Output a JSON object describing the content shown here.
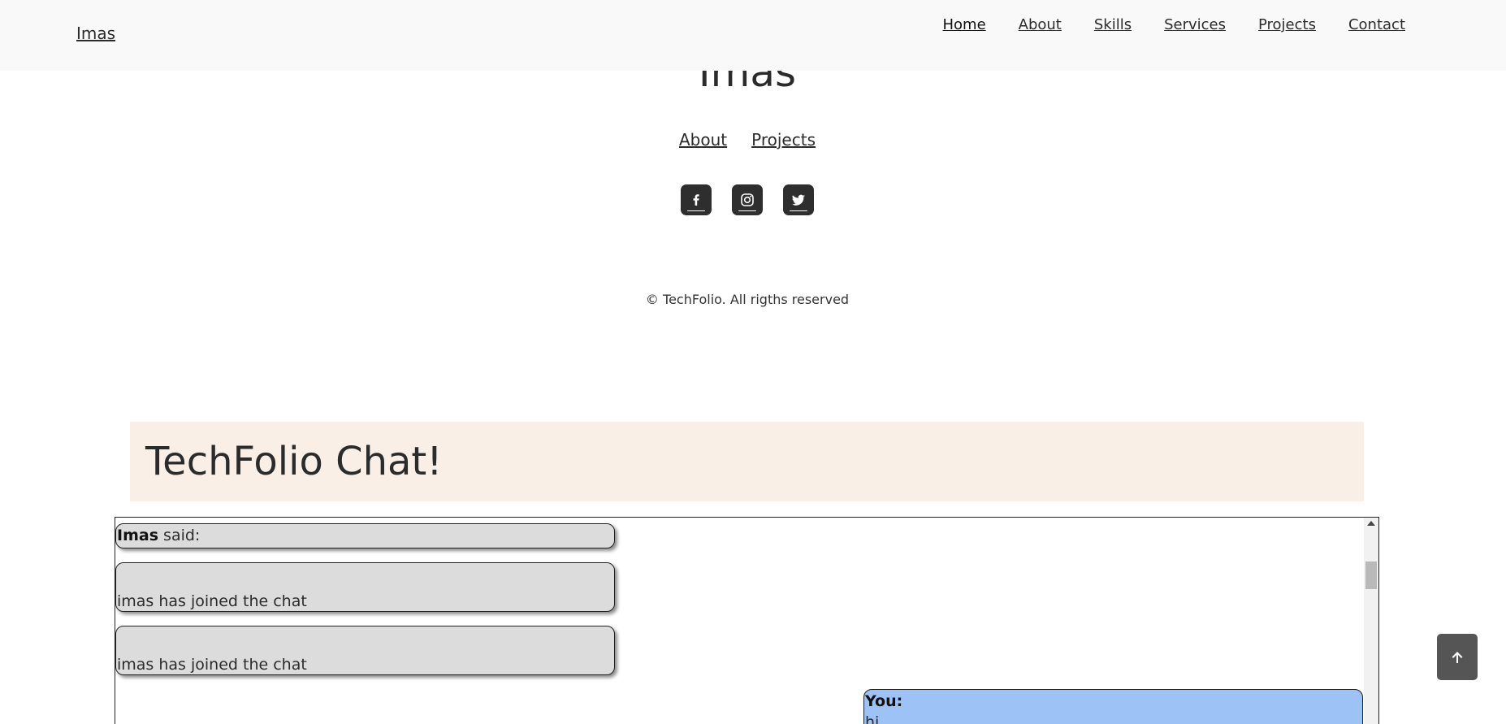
{
  "navbar": {
    "brand": "Imas",
    "links": [
      {
        "label": "Home"
      },
      {
        "label": "About"
      },
      {
        "label": "Skills"
      },
      {
        "label": "Services"
      },
      {
        "label": "Projects"
      },
      {
        "label": "Contact"
      }
    ]
  },
  "footer": {
    "title": "Imas",
    "links": [
      {
        "label": "About"
      },
      {
        "label": "Projects"
      }
    ],
    "socials": [
      "facebook-icon",
      "instagram-icon",
      "twitter-icon"
    ],
    "copyright": "© TechFolio. All rigths reserved"
  },
  "chat": {
    "title": "TechFolio Chat!",
    "messages": [
      {
        "sender": "Imas",
        "suffix": " said:"
      },
      {
        "text": "imas has joined the chat"
      },
      {
        "text": "imas has joined the chat"
      },
      {
        "sender": "You:",
        "text": "hi"
      }
    ]
  },
  "colors": {
    "navbar_bg": "#f9f9f9",
    "chat_header_bg": "#f9efe6",
    "other_message_bg": "#dcdcdc",
    "own_message_bg": "#9dc2f5",
    "social_bg": "#2e2e2e",
    "back_to_top_bg": "#555555"
  },
  "icons": {
    "back_to_top": "arrow-up-icon"
  }
}
